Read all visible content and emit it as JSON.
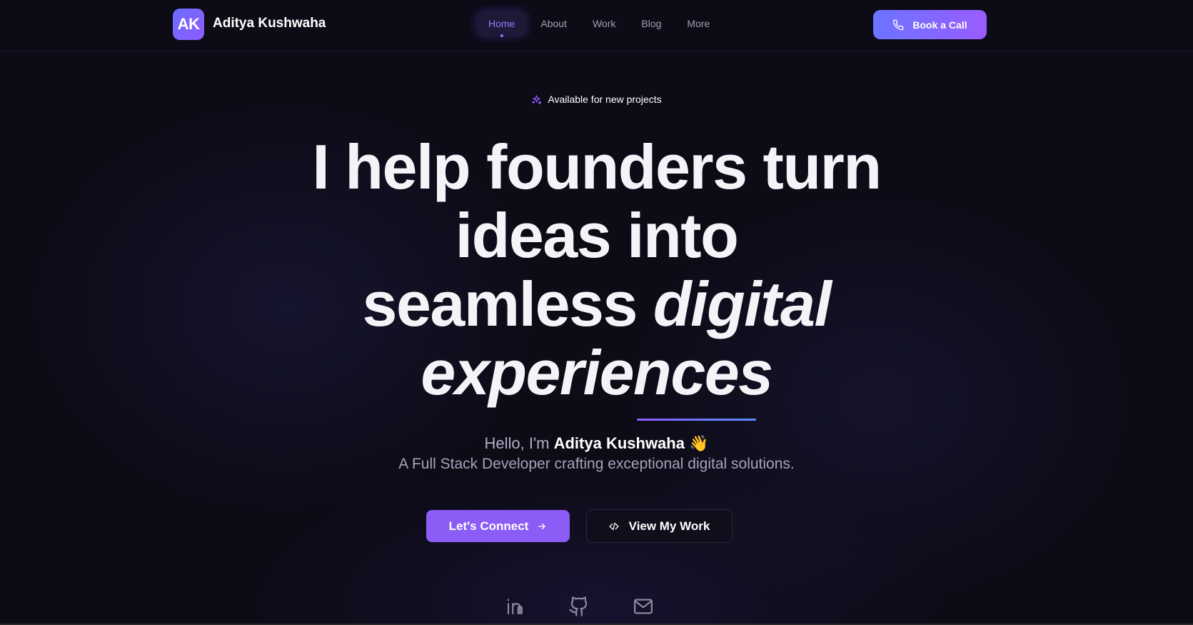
{
  "nav": {
    "logo_text": "AK",
    "brand": "Aditya Kushwaha",
    "items": [
      {
        "label": "Home",
        "active": true
      },
      {
        "label": "About",
        "active": false
      },
      {
        "label": "Work",
        "active": false
      },
      {
        "label": "Blog",
        "active": false
      },
      {
        "label": "More",
        "active": false
      }
    ],
    "cta_label": "Book a Call",
    "cta_icon": "phone-icon"
  },
  "hero": {
    "badge_icon": "sparkles-icon",
    "badge": "Available for new projects",
    "headline_line1": "I help founders turn",
    "headline_line2": "ideas into",
    "headline_line3_plain": "seamless ",
    "headline_line3_italic": "digital",
    "headline_line4_italic": "experiences",
    "greeting_prefix": "Hello, I'm ",
    "greeting_name": "Aditya Kushwaha",
    "greeting_emoji": "👋",
    "tagline": "A Full Stack Developer crafting exceptional digital solutions.",
    "primary_button": "Let's Connect",
    "secondary_button": "View My Work"
  },
  "socials": [
    {
      "icon": "linkedin-icon"
    },
    {
      "icon": "github-icon"
    },
    {
      "icon": "mail-icon"
    }
  ],
  "colors": {
    "background": "#0c0b16",
    "accent": "#8b5cf6",
    "accent_blue": "#6c74ff",
    "nav_active": "#8f7cff"
  }
}
